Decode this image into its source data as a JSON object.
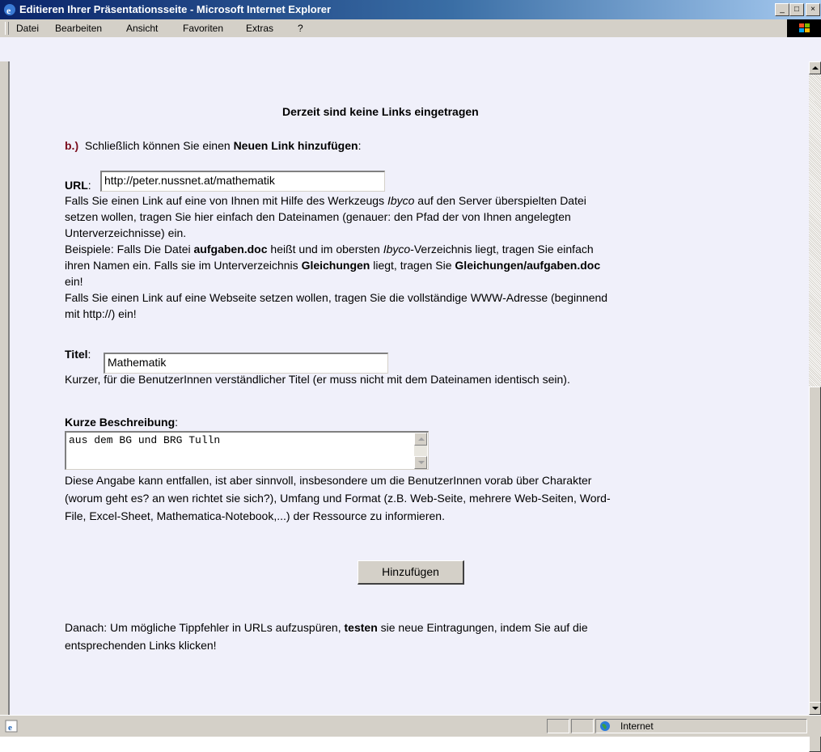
{
  "window": {
    "title": "Editieren Ihrer Präsentationsseite - Microsoft Internet Explorer",
    "minimize": "_",
    "maximize": "□",
    "close": "×"
  },
  "menu": {
    "items": [
      {
        "label": "Datei"
      },
      {
        "label": "Bearbeiten"
      },
      {
        "label": "Ansicht"
      },
      {
        "label": "Favoriten"
      },
      {
        "label": "Extras"
      },
      {
        "label": "?"
      }
    ]
  },
  "page": {
    "heading": "Derzeit sind keine Links eingetragen",
    "step_marker": "b.)",
    "step_text_pre": "Schließlich können Sie einen ",
    "step_text_bold": "Neuen Link hinzufügen",
    "step_text_post": ":",
    "url_label": "URL",
    "url_value": "http://peter.nussnet.at/mathematik",
    "url_help_line1_pre": "Falls Sie einen Link auf eine von Ihnen mit Hilfe des Werkzeugs ",
    "url_help_line1_it": "Ibyco",
    "url_help_line1_post": " auf den Server überspielten Datei",
    "url_help_line2": "setzen wollen, tragen Sie hier einfach den Dateinamen (genauer: den Pfad der von Ihnen angelegten",
    "url_help_line3": "Unterverzeichnisse) ein.",
    "example_line1_a": "Beispiele: Falls Die Datei ",
    "example_line1_b": "aufgaben.doc",
    "example_line1_c": " heißt und im obersten ",
    "example_line1_d": "Ibyco",
    "example_line1_e": "-Verzeichnis liegt, tragen Sie einfach",
    "example_line2_a": "ihren Namen ein. Falls sie im Unterverzeichnis ",
    "example_line2_b": "Gleichungen",
    "example_line2_c": " liegt, tragen Sie ",
    "example_line2_d": "Gleichungen/aufgaben.doc",
    "example_line3": "ein!",
    "web_line1": "Falls Sie einen Link auf eine Webseite setzen wollen, tragen Sie die vollständige WWW-Adresse (beginnend",
    "web_line2": "mit http://) ein!",
    "title_label": "Titel",
    "title_value": "Mathematik",
    "title_help": "Kurzer, für die BenutzerInnen verständlicher Titel (er muss nicht mit dem Dateinamen identisch sein).",
    "desc_label": "Kurze Beschreibung",
    "desc_value": "aus dem BG und BRG Tulln",
    "desc_help_line1": "Diese Angabe kann entfallen, ist aber sinnvoll, insbesondere um die BenutzerInnen vorab über Charakter",
    "desc_help_line2": "(worum geht es? an wen richtet sie sich?), Umfang und Format (z.B. Web-Seite, mehrere Web-Seiten, Word-",
    "desc_help_line3": "File, Excel-Sheet, Mathematica-Notebook,...) der Ressource zu informieren.",
    "submit_label": "Hinzufügen",
    "after_line1_pre": "Danach: Um mögliche Tippfehler in URLs aufzuspüren, ",
    "after_line1_bold": "testen",
    "after_line1_post": " sie neue Eintragungen, indem Sie auf die",
    "after_line2": "entsprechenden Links klicken!"
  },
  "status": {
    "zone": "Internet"
  },
  "colors": {
    "page_bg": "#f0f0fa",
    "marker": "#7a0c1c",
    "titlebar_start": "#0a246a"
  }
}
